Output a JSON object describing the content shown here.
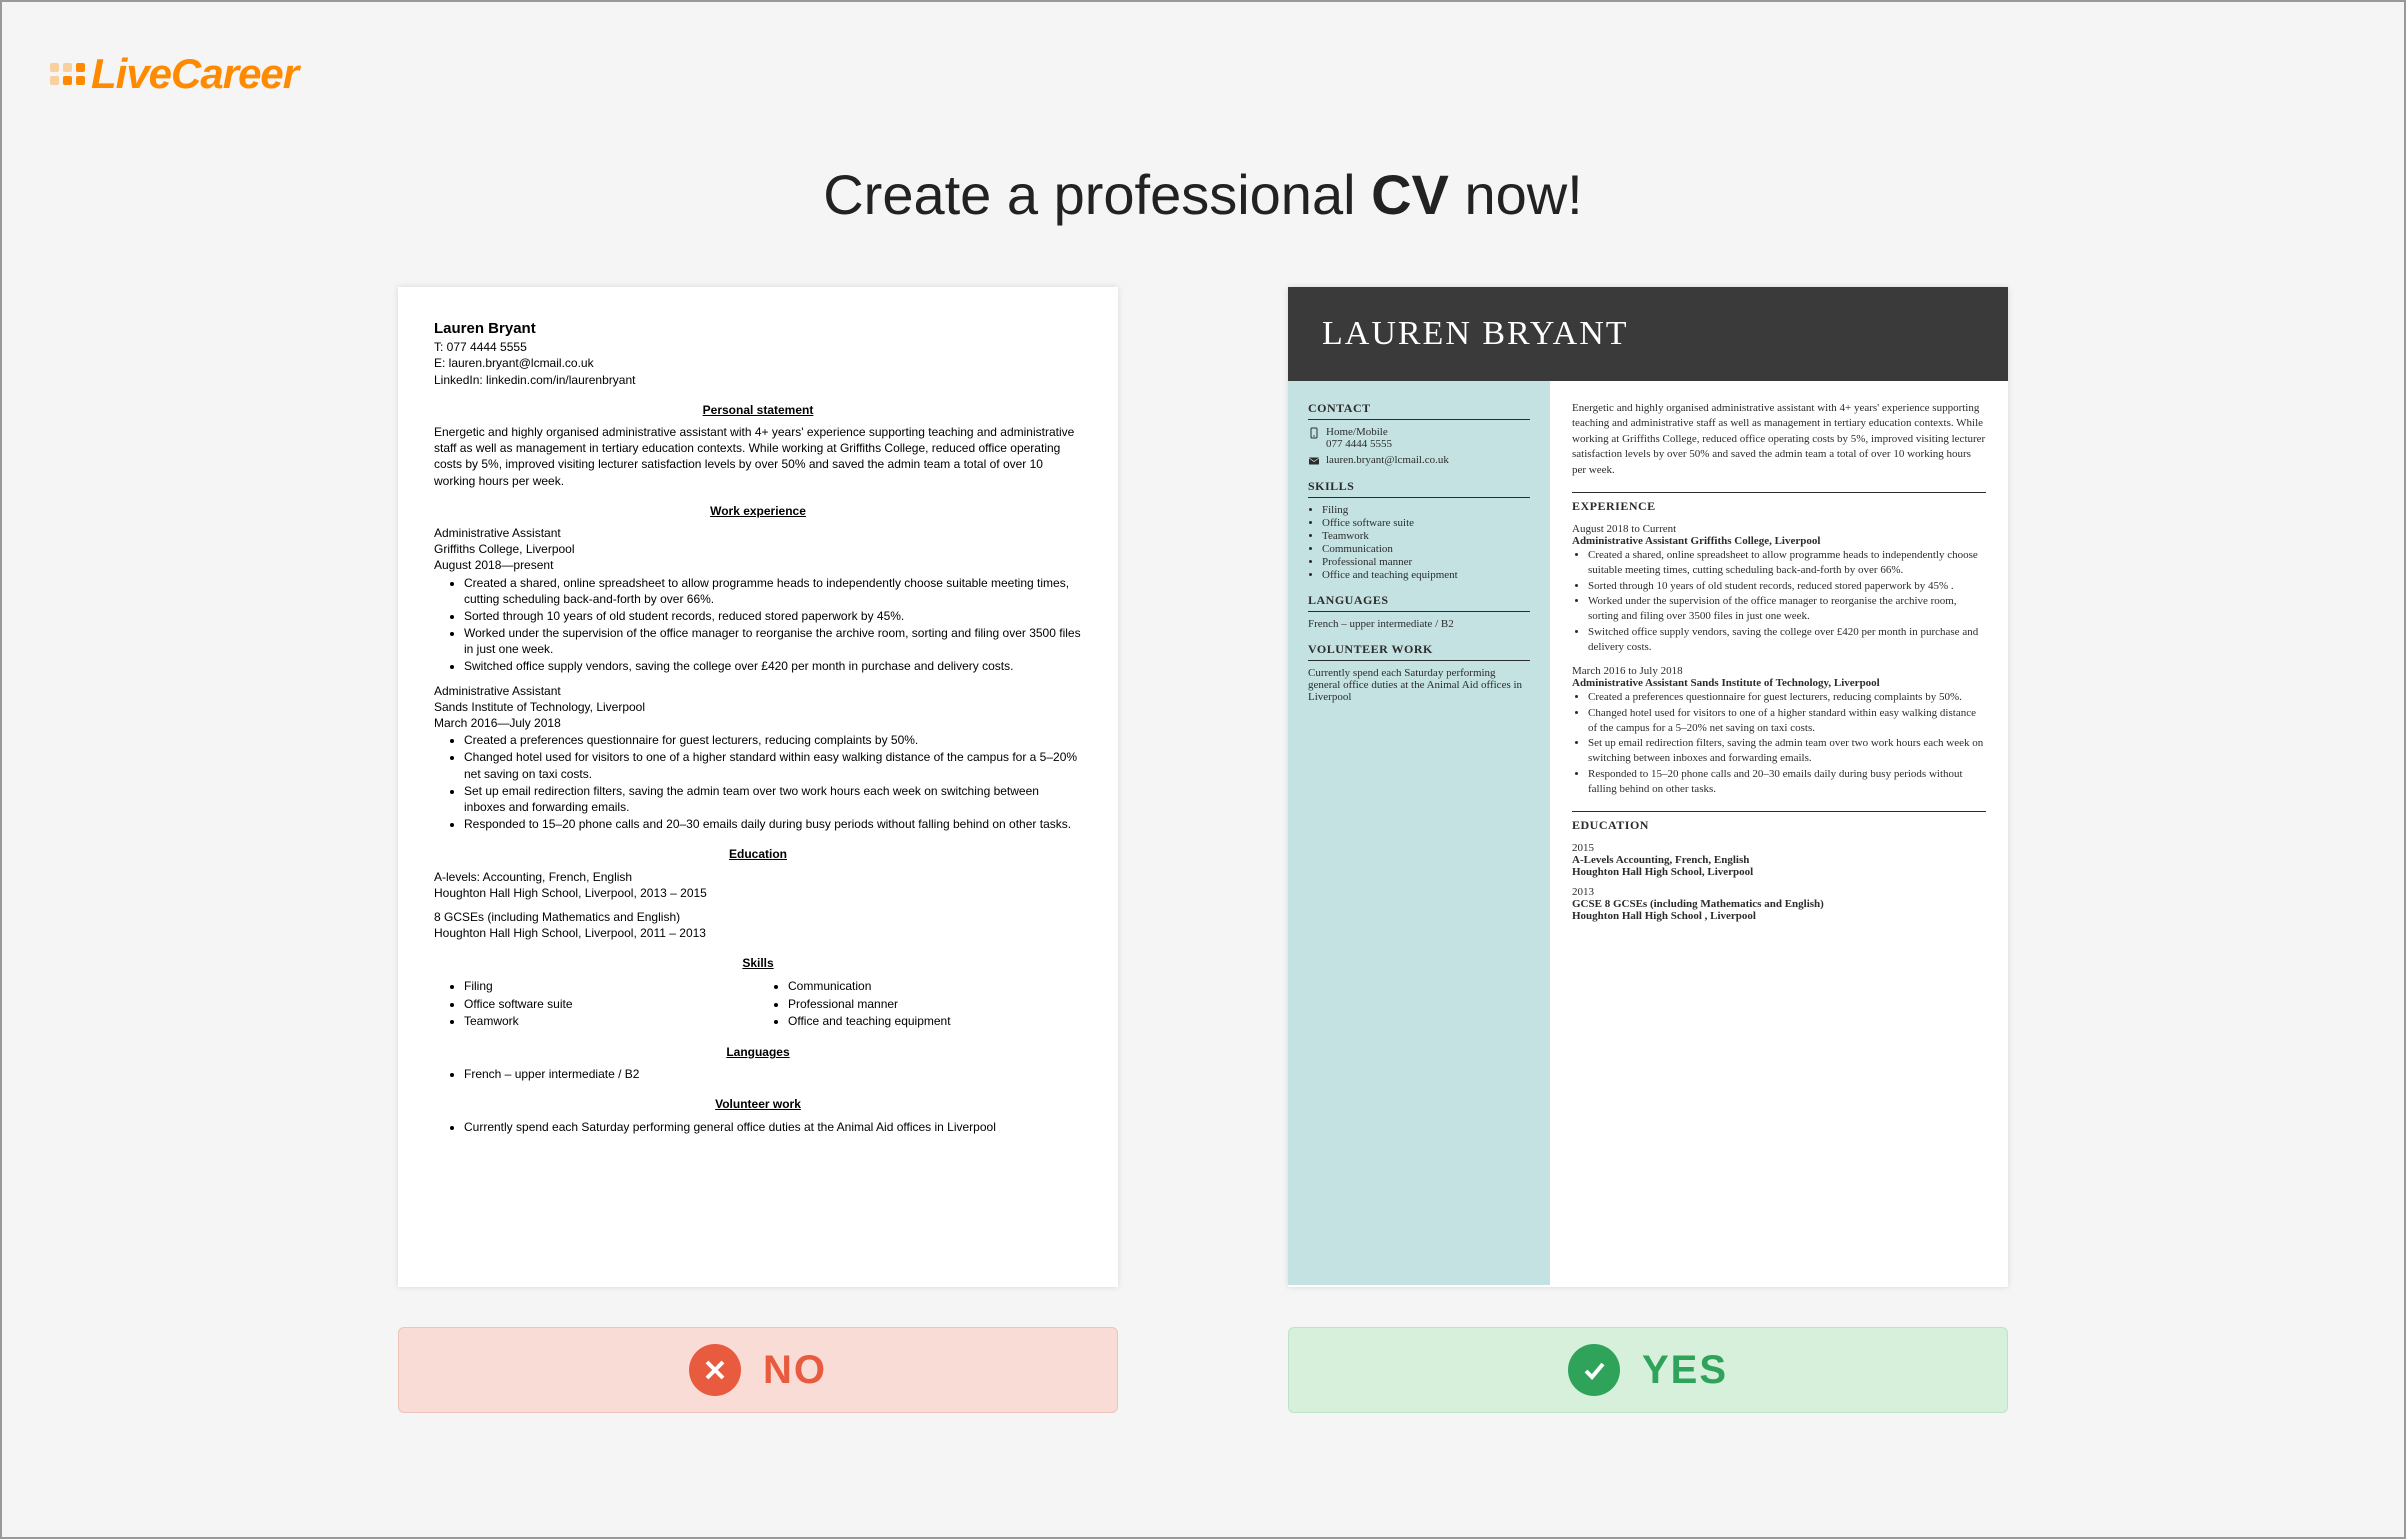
{
  "logo": {
    "text": "LiveCareer"
  },
  "heading": {
    "pre": "Create a professional ",
    "strong": "CV",
    "post": " now!"
  },
  "buttons": {
    "no": "NO",
    "yes": "YES"
  },
  "plain": {
    "name": "Lauren Bryant",
    "phone": "T: 077 4444 5555",
    "email": "E: lauren.bryant@lcmail.co.uk",
    "linkedin": "LinkedIn: linkedin.com/in/laurenbryant",
    "sec_personal": "Personal statement",
    "personal": "Energetic and highly organised administrative assistant with 4+ years' experience supporting teaching and administrative staff as well as management in tertiary education contexts. While working at Griffiths College, reduced office operating costs by 5%, improved visiting lecturer satisfaction levels by over 50% and saved the admin team a total of over 10 working hours per week.",
    "sec_work": "Work experience",
    "job1_title": "Administrative Assistant",
    "job1_org": "Griffiths College, Liverpool",
    "job1_dates": "August 2018—present",
    "job1_bullets": [
      "Created a shared, online spreadsheet to allow programme heads to independently choose suitable meeting times, cutting scheduling back-and-forth by over 66%.",
      "Sorted through 10 years of old student records, reduced stored paperwork by 45%.",
      "Worked under the supervision of the office manager to reorganise the archive room, sorting and filing over 3500 files in just one week.",
      "Switched office supply vendors, saving the college over £420 per month in purchase and delivery costs."
    ],
    "job2_title": "Administrative Assistant",
    "job2_org": "Sands Institute of Technology, Liverpool",
    "job2_dates": "March 2016—July 2018",
    "job2_bullets": [
      "Created a preferences questionnaire for guest lecturers, reducing complaints by 50%.",
      "Changed hotel used for visitors to one of a higher standard within easy walking distance of the campus for a 5–20% net saving on taxi costs.",
      "Set up email redirection filters, saving the admin team over two work hours each week on switching between inboxes and forwarding emails.",
      "Responded to 15–20 phone calls and 20–30 emails daily during busy periods without falling behind on other tasks."
    ],
    "sec_edu": "Education",
    "edu1_a": "A-levels: Accounting, French, English",
    "edu1_b": "Houghton Hall High School, Liverpool, 2013 – 2015",
    "edu2_a": "8 GCSEs (including Mathematics and English)",
    "edu2_b": "Houghton Hall High School, Liverpool, 2011 – 2013",
    "sec_skills": "Skills",
    "skills_l": [
      "Filing",
      "Office software suite",
      "Teamwork"
    ],
    "skills_r": [
      "Communication",
      "Professional manner",
      "Office and teaching equipment"
    ],
    "sec_lang": "Languages",
    "lang": "French – upper intermediate / B2",
    "sec_vol": "Volunteer work",
    "vol": "Currently spend each Saturday performing general office duties at the Animal Aid offices in Liverpool"
  },
  "styled": {
    "name": "LAUREN BRYANT",
    "sec_contact": "CONTACT",
    "contact_phone_label": "Home/Mobile",
    "contact_phone": "077 4444 5555",
    "contact_email": "lauren.bryant@lcmail.co.uk",
    "sec_skills": "SKILLS",
    "skills": [
      "Filing",
      "Office software suite",
      "Teamwork",
      "Communication",
      "Professional manner",
      "Office and teaching equipment"
    ],
    "sec_lang": "LANGUAGES",
    "lang": "French – upper intermediate / B2",
    "sec_vol": "VOLUNTEER WORK",
    "vol": "Currently spend each Saturday performing general office duties at the Animal Aid offices in Liverpool",
    "summary": "Energetic and highly organised administrative assistant with 4+ years' experience supporting teaching and administrative staff as well as management in tertiary education contexts. While working at Griffiths College, reduced office operating costs by 5%, improved visiting lecturer satisfaction levels by over 50% and saved the admin team a total of over 10 working hours per week.",
    "sec_exp": "EXPERIENCE",
    "job1_dates": "August 2018 to Current",
    "job1_title": "Administrative Assistant Griffiths College, Liverpool",
    "job1_bullets": [
      "Created a shared, online spreadsheet to allow programme heads to independently choose suitable meeting times, cutting scheduling back-and-forth by over 66%.",
      "Sorted through 10 years of old student records, reduced stored paperwork by 45% .",
      "Worked under the supervision of the office manager to reorganise the archive room, sorting and filing over 3500 files in just one week.",
      "Switched office supply vendors, saving the college over £420 per month in purchase and delivery costs."
    ],
    "job2_dates": "March 2016 to July 2018",
    "job2_title": "Administrative Assistant Sands Institute of Technology, Liverpool",
    "job2_bullets": [
      "Created a preferences questionnaire for guest lecturers, reducing complaints by 50%.",
      "Changed hotel used for visitors to one of a higher standard within easy walking distance of the campus for a 5–20% net saving on taxi costs.",
      "Set up email redirection filters, saving the admin team over two work hours each week on switching between inboxes and forwarding emails.",
      "Responded to 15–20 phone calls and 20–30 emails daily during busy periods without falling behind on other tasks."
    ],
    "sec_edu": "EDUCATION",
    "edu1_y": "2015",
    "edu1_a": "A-Levels Accounting, French, English",
    "edu1_b": "Houghton Hall High School, Liverpool",
    "edu2_y": "2013",
    "edu2_a": "GCSE 8 GCSEs (including Mathematics and English)",
    "edu2_b": "Houghton Hall High School , Liverpool"
  }
}
